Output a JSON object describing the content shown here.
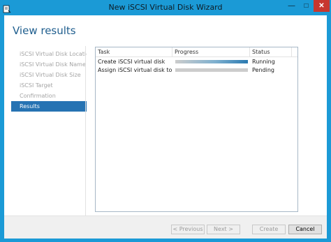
{
  "window": {
    "title": "New iSCSI Virtual Disk Wizard",
    "controls": {
      "minimize": "—",
      "maximize": "□",
      "close": "✕"
    }
  },
  "page": {
    "heading": "View results"
  },
  "nav": {
    "items": [
      {
        "label": "iSCSI Virtual Disk Location",
        "active": false
      },
      {
        "label": "iSCSI Virtual Disk Name",
        "active": false
      },
      {
        "label": "iSCSI Virtual Disk Size",
        "active": false
      },
      {
        "label": "iSCSI Target",
        "active": false
      },
      {
        "label": "Confirmation",
        "active": false
      },
      {
        "label": "Results",
        "active": true
      }
    ]
  },
  "grid": {
    "columns": {
      "task": "Task",
      "progress": "Progress",
      "status": "Status"
    },
    "rows": [
      {
        "task": "Create iSCSI virtual disk",
        "progress": 1.0,
        "status": "Running"
      },
      {
        "task": "Assign iSCSI virtual disk to target",
        "progress": 1.0,
        "status": "Pending"
      }
    ]
  },
  "buttons": {
    "previous": "< Previous",
    "next": "Next >",
    "create": "Create",
    "cancel": "Cancel"
  },
  "colors": {
    "titlebar": "#1b9ad6",
    "accent": "#2673b3",
    "heading": "#1f5e8e",
    "close": "#c7372f",
    "progress_running": "#2a7ab0",
    "progress_pending": "#cccccc"
  },
  "icons": {
    "app": "wizard-app-icon"
  }
}
